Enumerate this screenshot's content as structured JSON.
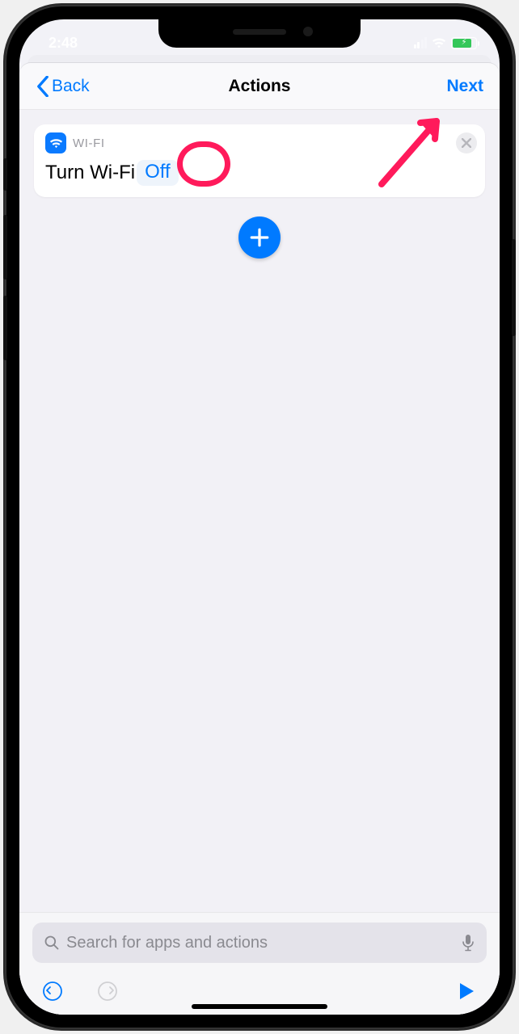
{
  "status": {
    "time": "2:48"
  },
  "nav": {
    "back_label": "Back",
    "title": "Actions",
    "next_label": "Next"
  },
  "action_card": {
    "app_label": "WI-FI",
    "phrase_prefix": "Turn Wi-Fi",
    "param_value": "Off"
  },
  "search": {
    "placeholder": "Search for apps and actions"
  },
  "colors": {
    "accent": "#007aff",
    "annotation": "#ff1a5b",
    "battery_fill": "#34c759"
  }
}
